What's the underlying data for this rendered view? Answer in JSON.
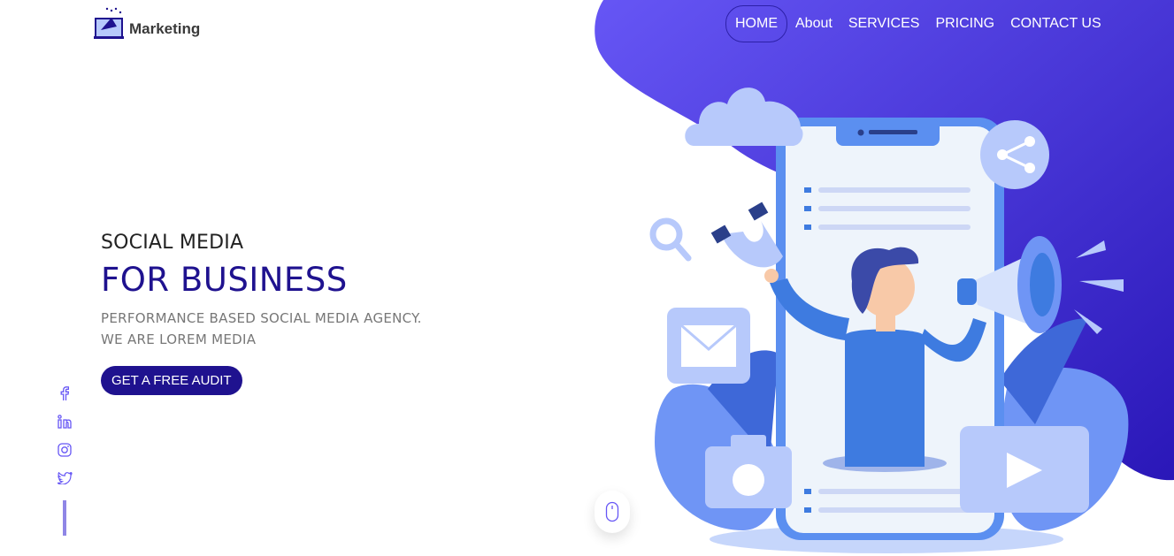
{
  "brand": {
    "name": "Marketing",
    "icon": "megaphone-logo-icon"
  },
  "nav": {
    "items": [
      {
        "label": "HOME",
        "active": true
      },
      {
        "label": "About",
        "active": false
      },
      {
        "label": "SERVICES",
        "active": false
      },
      {
        "label": "PRICING",
        "active": false
      },
      {
        "label": "CONTACT US",
        "active": false
      }
    ]
  },
  "hero": {
    "subtitle": "SOCIAL MEDIA",
    "title": "FOR BUSINESS",
    "description_line1": "PERFORMANCE BASED SOCIAL MEDIA AGENCY.",
    "description_line2": "WE ARE LOREM MEDIA",
    "cta_label": "GET A FREE AUDIT"
  },
  "social": [
    "facebook-icon",
    "linkedin-icon",
    "instagram-icon",
    "twitter-icon"
  ],
  "colors": {
    "accent": "#1f128f",
    "blob_start": "#6656f5",
    "blob_end": "#2a17b8",
    "illustration_light": "#b7c9fb",
    "illustration_blue": "#3e7be0"
  }
}
